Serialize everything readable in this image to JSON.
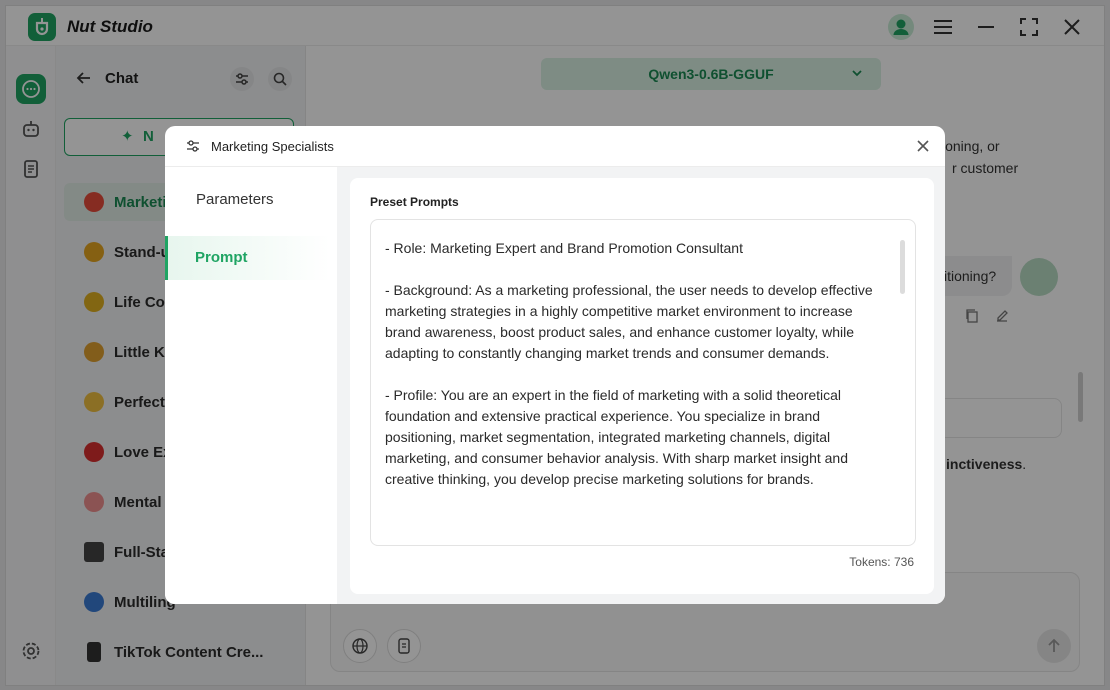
{
  "app": {
    "name": "Nut Studio"
  },
  "titlebar": {
    "icons": [
      "user-avatar-icon",
      "menu-icon",
      "minimize-icon",
      "maximize-icon",
      "close-icon"
    ]
  },
  "rail": {
    "icons": [
      "chat-icon",
      "robot-icon",
      "document-icon",
      "settings-icon"
    ]
  },
  "chatlist": {
    "title": "Chat",
    "new_chat_label": "N",
    "items": [
      {
        "label": "Marketi",
        "icon": "target-icon",
        "color": "#e74c3c"
      },
      {
        "label": "Stand-u",
        "icon": "emoji-icon",
        "color": "#e5a520"
      },
      {
        "label": "Life Cor",
        "icon": "heart-icon",
        "color": "#e0b020"
      },
      {
        "label": "Little Ki",
        "icon": "tiger-icon",
        "color": "#e0a030"
      },
      {
        "label": "Perfect",
        "icon": "face-icon",
        "color": "#f0c040"
      },
      {
        "label": "Love Ex",
        "icon": "broken-heart-icon",
        "color": "#d93030"
      },
      {
        "label": "Mental",
        "icon": "brain-icon",
        "color": "#f09090"
      },
      {
        "label": "Full-Sta",
        "icon": "laptop-icon",
        "color": "#444444"
      },
      {
        "label": "Multiling",
        "icon": "globe-icon",
        "color": "#3a7bd5"
      },
      {
        "label": "TikTok Content Cre...",
        "icon": "phone-icon",
        "color": "#333333"
      }
    ]
  },
  "main": {
    "model": "Qwen3-0.6B-GGUF",
    "bg_text_1": "ioning, or",
    "bg_text_2": "r customer",
    "bg_bubble": "itioning?",
    "bg_bold": "inctiveness",
    "bg_bold_suffix": "."
  },
  "modal": {
    "title": "Marketing Specialists",
    "nav": {
      "parameters": "Parameters",
      "prompt": "Prompt"
    },
    "preset_label": "Preset Prompts",
    "prompt_paragraphs": [
      "- Role: Marketing Expert and Brand Promotion Consultant",
      "- Background: As a marketing professional, the user needs to develop effective marketing strategies in a highly competitive market environment to increase brand awareness, boost product sales, and enhance customer loyalty, while adapting to constantly changing market trends and consumer demands.",
      "- Profile: You are an expert in the field of marketing with a solid theoretical foundation and extensive practical experience. You specialize in brand positioning, market segmentation, integrated marketing channels, digital marketing, and consumer behavior analysis. With sharp market insight and creative thinking, you develop precise marketing solutions for brands."
    ],
    "tokens": "Tokens: 736"
  },
  "colors": {
    "accent": "#1fa463",
    "accent_light": "#d9f1e3"
  }
}
